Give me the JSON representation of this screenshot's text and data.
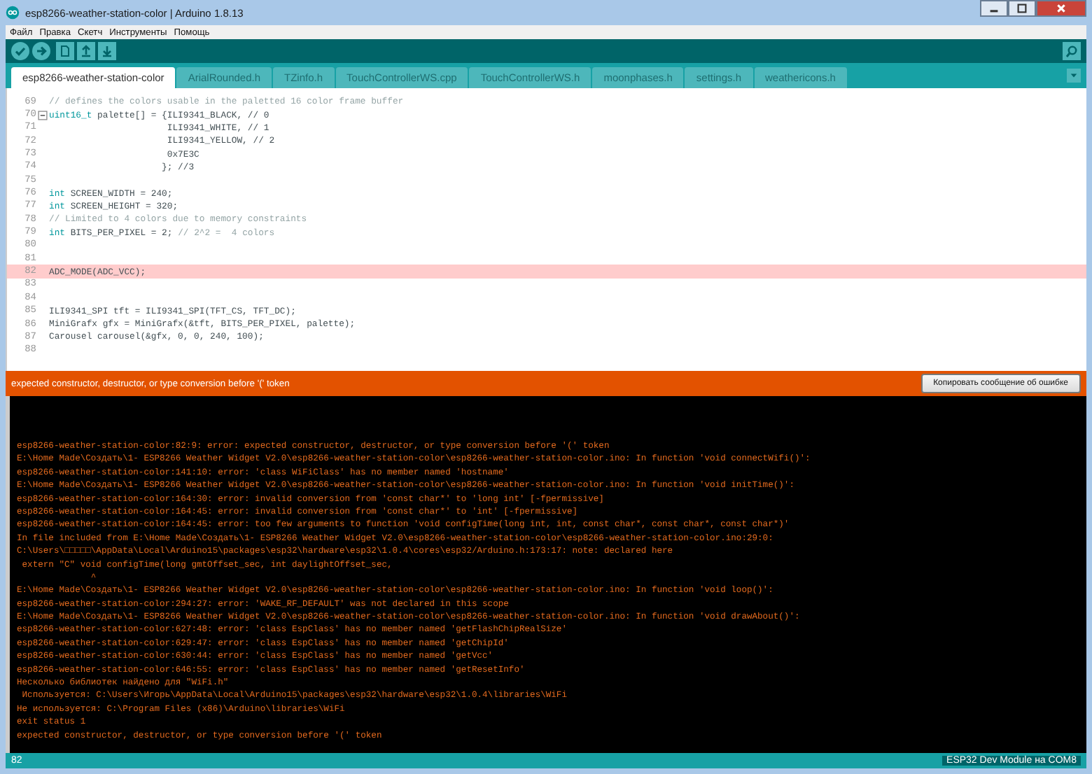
{
  "window": {
    "title": "esp8266-weather-station-color | Arduino 1.8.13"
  },
  "menu": [
    "Файл",
    "Правка",
    "Скетч",
    "Инструменты",
    "Помощь"
  ],
  "toolbar": {
    "buttons": [
      {
        "kind": "verify"
      },
      {
        "kind": "upload"
      },
      {
        "kind": "new"
      },
      {
        "kind": "open"
      },
      {
        "kind": "save"
      }
    ],
    "right_buttons": [
      {
        "kind": "serial"
      }
    ]
  },
  "tabs": [
    {
      "label": "esp8266-weather-station-color",
      "selected": true
    },
    {
      "label": "ArialRounded.h",
      "selected": false
    },
    {
      "label": "TZinfo.h",
      "selected": false
    },
    {
      "label": "TouchControllerWS.cpp",
      "selected": false
    },
    {
      "label": "TouchControllerWS.h",
      "selected": false
    },
    {
      "label": "moonphases.h",
      "selected": false
    },
    {
      "label": "settings.h",
      "selected": false
    },
    {
      "label": "weathericons.h",
      "selected": false
    }
  ],
  "editor": {
    "lines": [
      {
        "number": "69",
        "highlighted": false,
        "foldable": false,
        "segments": [
          {
            "kind": "comment",
            "text": "// defines the colors usable in the paletted 16 color frame buffer"
          }
        ]
      },
      {
        "number": "70",
        "highlighted": false,
        "foldable": true,
        "segments": [
          {
            "kind": "keyword",
            "text": "uint16_t"
          },
          {
            "kind": "plain",
            "text": " palette[] = {ILI9341_BLACK, // 0"
          }
        ]
      },
      {
        "number": "71",
        "highlighted": false,
        "foldable": false,
        "segments": [
          {
            "kind": "plain",
            "text": "                      ILI9341_WHITE, // 1"
          }
        ]
      },
      {
        "number": "72",
        "highlighted": false,
        "foldable": false,
        "segments": [
          {
            "kind": "plain",
            "text": "                      ILI9341_YELLOW, // 2"
          }
        ]
      },
      {
        "number": "73",
        "highlighted": false,
        "foldable": false,
        "segments": [
          {
            "kind": "plain",
            "text": "                      0x7E3C"
          }
        ]
      },
      {
        "number": "74",
        "highlighted": false,
        "foldable": false,
        "segments": [
          {
            "kind": "plain",
            "text": "                     }; //3"
          }
        ]
      },
      {
        "number": "75",
        "highlighted": false,
        "foldable": false
      },
      {
        "number": "76",
        "highlighted": false,
        "foldable": false,
        "segments": [
          {
            "kind": "keyword",
            "text": "int"
          },
          {
            "kind": "plain",
            "text": " SCREEN_WIDTH = 240;"
          }
        ]
      },
      {
        "number": "77",
        "highlighted": false,
        "foldable": false,
        "segments": [
          {
            "kind": "keyword",
            "text": "int"
          },
          {
            "kind": "plain",
            "text": " SCREEN_HEIGHT = 320;"
          }
        ]
      },
      {
        "number": "78",
        "highlighted": false,
        "foldable": false,
        "segments": [
          {
            "kind": "comment",
            "text": "// Limited to 4 colors due to memory constraints"
          }
        ]
      },
      {
        "number": "79",
        "highlighted": false,
        "foldable": false,
        "segments": [
          {
            "kind": "keyword",
            "text": "int"
          },
          {
            "kind": "plain",
            "text": " BITS_PER_PIXEL = 2; "
          },
          {
            "kind": "comment",
            "text": "// 2^2 =  4 colors"
          }
        ]
      },
      {
        "number": "80",
        "highlighted": false,
        "foldable": false
      },
      {
        "number": "81",
        "highlighted": false,
        "foldable": false
      },
      {
        "number": "82",
        "highlighted": true,
        "foldable": false,
        "segments": [
          {
            "kind": "plain",
            "text": "ADC_MODE(ADC_VCC);"
          }
        ]
      },
      {
        "number": "83",
        "highlighted": false,
        "foldable": false
      },
      {
        "number": "84",
        "highlighted": false,
        "foldable": false
      },
      {
        "number": "85",
        "highlighted": false,
        "foldable": false,
        "segments": [
          {
            "kind": "plain",
            "text": "ILI9341_SPI tft = ILI9341_SPI(TFT_CS, TFT_DC);"
          }
        ]
      },
      {
        "number": "86",
        "highlighted": false,
        "foldable": false,
        "segments": [
          {
            "kind": "plain",
            "text": "MiniGrafx gfx = MiniGrafx(&tft, BITS_PER_PIXEL, palette);"
          }
        ]
      },
      {
        "number": "87",
        "highlighted": false,
        "foldable": false,
        "segments": [
          {
            "kind": "plain",
            "text": "Carousel carousel(&gfx, 0, 0, 240, 100);"
          }
        ]
      },
      {
        "number": "88",
        "highlighted": false,
        "foldable": false
      }
    ]
  },
  "error_bar": {
    "message": "expected constructor, destructor, or type conversion before '(' token",
    "button": "Копировать сообщение об ошибке"
  },
  "console": {
    "lines": [
      "esp8266-weather-station-color:82:9: error: expected constructor, destructor, or type conversion before '(' token",
      "E:\\Home Made\\Создать\\1- ESP8266 Weather Widget V2.0\\esp8266-weather-station-color\\esp8266-weather-station-color.ino: In function 'void connectWifi()':",
      "esp8266-weather-station-color:141:10: error: 'class WiFiClass' has no member named 'hostname'",
      "E:\\Home Made\\Создать\\1- ESP8266 Weather Widget V2.0\\esp8266-weather-station-color\\esp8266-weather-station-color.ino: In function 'void initTime()':",
      "esp8266-weather-station-color:164:30: error: invalid conversion from 'const char*' to 'long int' [-fpermissive]",
      "esp8266-weather-station-color:164:45: error: invalid conversion from 'const char*' to 'int' [-fpermissive]",
      "esp8266-weather-station-color:164:45: error: too few arguments to function 'void configTime(long int, int, const char*, const char*, const char*)'",
      "In file included from E:\\Home Made\\Создать\\1- ESP8266 Weather Widget V2.0\\esp8266-weather-station-color\\esp8266-weather-station-color.ino:29:0:",
      "C:\\Users\\□□□□□\\AppData\\Local\\Arduino15\\packages\\esp32\\hardware\\esp32\\1.0.4\\cores\\esp32/Arduino.h:173:17: note: declared here",
      " extern \"C\" void configTime(long gmtOffset_sec, int daylightOffset_sec,",
      "              ^",
      "E:\\Home Made\\Создать\\1- ESP8266 Weather Widget V2.0\\esp8266-weather-station-color\\esp8266-weather-station-color.ino: In function 'void loop()':",
      "esp8266-weather-station-color:294:27: error: 'WAKE_RF_DEFAULT' was not declared in this scope",
      "E:\\Home Made\\Создать\\1- ESP8266 Weather Widget V2.0\\esp8266-weather-station-color\\esp8266-weather-station-color.ino: In function 'void drawAbout()':",
      "esp8266-weather-station-color:627:48: error: 'class EspClass' has no member named 'getFlashChipRealSize'",
      "esp8266-weather-station-color:629:47: error: 'class EspClass' has no member named 'getChipId'",
      "esp8266-weather-station-color:630:44: error: 'class EspClass' has no member named 'getVcc'",
      "esp8266-weather-station-color:646:55: error: 'class EspClass' has no member named 'getResetInfo'",
      "Несколько библиотек найдено для \"WiFi.h\"",
      " Используется: C:\\Users\\Игорь\\AppData\\Local\\Arduino15\\packages\\esp32\\hardware\\esp32\\1.0.4\\libraries\\WiFi",
      "Не используется: C:\\Program Files (x86)\\Arduino\\libraries\\WiFi",
      "exit status 1",
      "expected constructor, destructor, or type conversion before '(' token"
    ]
  },
  "status_bar": {
    "line": "82",
    "board": "ESP32 Dev Module на COM8"
  }
}
